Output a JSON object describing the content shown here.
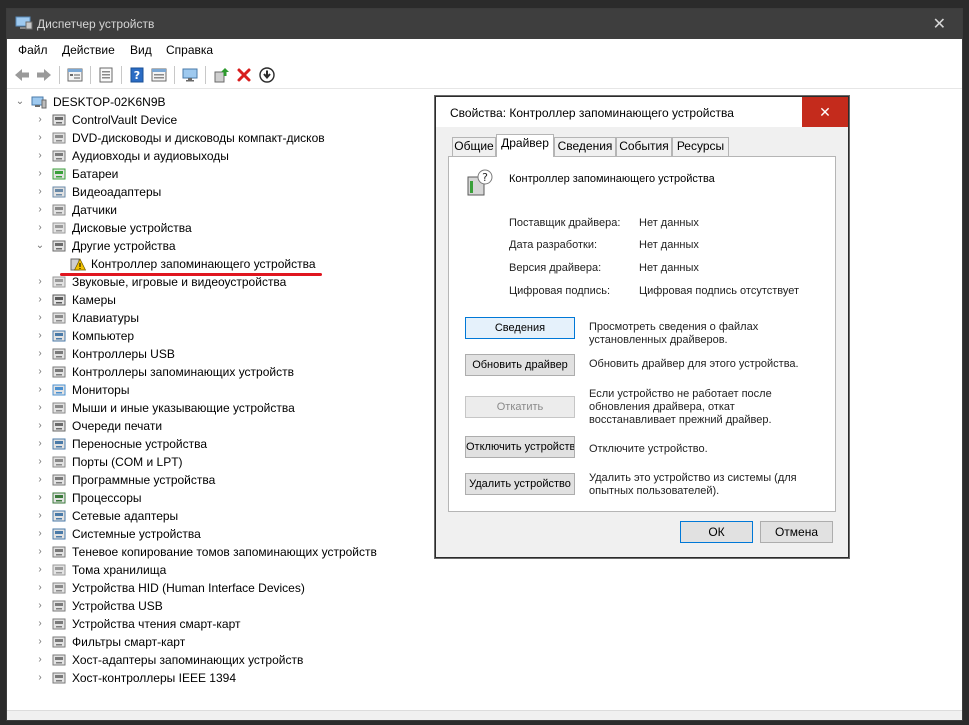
{
  "window": {
    "title": "Диспетчер устройств",
    "close_glyph": "✕"
  },
  "menu": [
    "Файл",
    "Действие",
    "Вид",
    "Справка"
  ],
  "toolbar": {
    "icons": [
      "back-icon",
      "forward-icon",
      "tree-view-icon",
      "properties-icon",
      "help-icon",
      "details-view-icon",
      "monitor-icon",
      "update-driver-icon",
      "uninstall-icon",
      "download-icon"
    ]
  },
  "tree": {
    "root": "DESKTOP-02K6N9B",
    "categories": [
      {
        "label": "ControlVault Device",
        "icon": "controlvault-icon"
      },
      {
        "label": "DVD-дисководы и дисководы компакт-дисков",
        "icon": "dvd-drive-icon"
      },
      {
        "label": "Аудиовходы и аудиовыходы",
        "icon": "audio-icon"
      },
      {
        "label": "Батареи",
        "icon": "battery-icon"
      },
      {
        "label": "Видеоадаптеры",
        "icon": "display-adapter-icon"
      },
      {
        "label": "Датчики",
        "icon": "sensor-icon"
      },
      {
        "label": "Дисковые устройства",
        "icon": "disk-drive-icon"
      },
      {
        "label": "Другие устройства",
        "icon": "other-devices-icon",
        "expanded": true,
        "children": [
          {
            "label": "Контроллер запоминающего устройства",
            "icon": "warning-device-icon"
          }
        ]
      },
      {
        "label": "Звуковые, игровые и видеоустройства",
        "icon": "sound-icon"
      },
      {
        "label": "Камеры",
        "icon": "camera-icon"
      },
      {
        "label": "Клавиатуры",
        "icon": "keyboard-icon"
      },
      {
        "label": "Компьютер",
        "icon": "computer-icon"
      },
      {
        "label": "Контроллеры USB",
        "icon": "usb-controller-icon"
      },
      {
        "label": "Контроллеры запоминающих устройств",
        "icon": "storage-controller-icon"
      },
      {
        "label": "Мониторы",
        "icon": "monitor-icon"
      },
      {
        "label": "Мыши и иные указывающие устройства",
        "icon": "mouse-icon"
      },
      {
        "label": "Очереди печати",
        "icon": "print-queue-icon"
      },
      {
        "label": "Переносные устройства",
        "icon": "portable-device-icon"
      },
      {
        "label": "Порты (COM и LPT)",
        "icon": "port-icon"
      },
      {
        "label": "Программные устройства",
        "icon": "software-device-icon"
      },
      {
        "label": "Процессоры",
        "icon": "processor-icon"
      },
      {
        "label": "Сетевые адаптеры",
        "icon": "network-adapter-icon"
      },
      {
        "label": "Системные устройства",
        "icon": "system-device-icon"
      },
      {
        "label": "Теневое копирование томов запоминающих устройств",
        "icon": "shadow-copy-icon"
      },
      {
        "label": "Тома хранилища",
        "icon": "storage-volume-icon"
      },
      {
        "label": "Устройства HID (Human Interface Devices)",
        "icon": "hid-icon"
      },
      {
        "label": "Устройства USB",
        "icon": "usb-device-icon"
      },
      {
        "label": "Устройства чтения смарт-карт",
        "icon": "smartcard-reader-icon"
      },
      {
        "label": "Фильтры смарт-карт",
        "icon": "smartcard-filter-icon"
      },
      {
        "label": "Хост-адаптеры запоминающих устройств",
        "icon": "host-adapter-icon"
      },
      {
        "label": "Хост-контроллеры IEEE 1394",
        "icon": "ieee1394-icon"
      }
    ]
  },
  "dialog": {
    "title": "Свойства: Контроллер запоминающего устройства",
    "close_glyph": "✕",
    "tabs": [
      "Общие",
      "Драйвер",
      "Сведения",
      "События",
      "Ресурсы"
    ],
    "active_tab": "Драйвер",
    "device_name": "Контроллер запоминающего устройства",
    "properties": [
      {
        "label": "Поставщик драйвера:",
        "value": "Нет данных"
      },
      {
        "label": "Дата разработки:",
        "value": "Нет данных"
      },
      {
        "label": "Версия драйвера:",
        "value": "Нет данных"
      },
      {
        "label": "Цифровая подпись:",
        "value": "Цифровая подпись отсутствует"
      }
    ],
    "actions": [
      {
        "label": "Сведения",
        "desc": "Просмотреть сведения о файлах установленных драйверов.",
        "enabled": true
      },
      {
        "label": "Обновить драйвер",
        "desc": "Обновить драйвер для этого устройства.",
        "enabled": true
      },
      {
        "label": "Откатить",
        "desc": "Если устройство не работает после обновления драйвера, откат восстанавливает прежний драйвер.",
        "enabled": false
      },
      {
        "label": "Отключить устройство",
        "desc": "Отключите устройство.",
        "enabled": true
      },
      {
        "label": "Удалить устройство",
        "desc": "Удалить это устройство из системы (для опытных пользователей).",
        "enabled": true
      }
    ],
    "ok": "ОК",
    "cancel": "Отмена"
  },
  "colors": {
    "highlight_red": "#e0161f",
    "titlebar": "#3e3e3e",
    "dialog_close": "#c42b1c",
    "warning": "#f2c200"
  }
}
